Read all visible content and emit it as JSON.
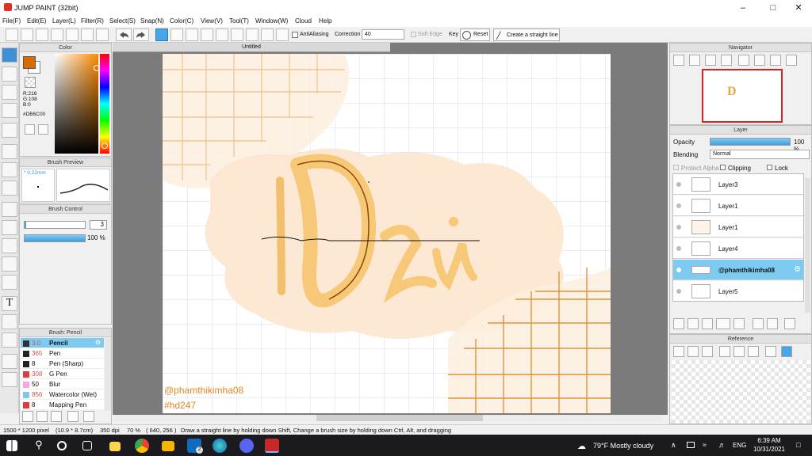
{
  "window": {
    "title": "JUMP PAINT (32bit)"
  },
  "menu": [
    "File(F)",
    "Edit(E)",
    "Layer(L)",
    "Filter(R)",
    "Select(S)",
    "Snap(N)",
    "Color(C)",
    "View(V)",
    "Tool(T)",
    "Window(W)",
    "Cloud",
    "Help"
  ],
  "toolbar": {
    "antialiasing_label": "AntiAliasing",
    "correction_label": "Correction",
    "correction_value": "40",
    "soft_edge_label": "Soft Edge",
    "key_label": "Key",
    "reset_label": "Reset",
    "straight_line_label": "Create a straight line"
  },
  "color_panel": {
    "title": "Color",
    "r": "R:216",
    "g": "G:108",
    "b": "B:0",
    "hex": "#DB6C00",
    "current_color": "#d86c00"
  },
  "brush_preview": {
    "title": "Brush Preview",
    "size": "* 0.22mm"
  },
  "brush_control": {
    "title": "Brush Control",
    "size_value": "3",
    "opacity_value": "100 %"
  },
  "brush_list": {
    "title": "Brush: Pencil",
    "items": [
      {
        "size": "3.0",
        "name": "Pencil",
        "color": "#333333"
      },
      {
        "size": "365",
        "name": "Pen",
        "color": "#222222"
      },
      {
        "size": "8",
        "name": "Pen (Sharp)",
        "color": "#222222"
      },
      {
        "size": "308",
        "name": "G Pen",
        "color": "#e03a3a"
      },
      {
        "size": "50",
        "name": "Blur",
        "color": "#f2a6e6"
      },
      {
        "size": "856",
        "name": "Watercolor (Wet)",
        "color": "#7ec8f0"
      },
      {
        "size": "8",
        "name": "Mapping Pen",
        "color": "#e03a3a"
      }
    ]
  },
  "canvas": {
    "tab": "Untitled",
    "watermark1": "@phamthikimha08",
    "watermark2": "#hd247"
  },
  "navigator": {
    "title": "Navigator"
  },
  "layer_panel": {
    "title": "Layer",
    "opacity_label": "Opacity",
    "opacity_value": "100 %",
    "blending_label": "Blending",
    "blending_value": "Normal",
    "protect_alpha": "Protect Alpha",
    "clipping": "Clipping",
    "lock": "Lock",
    "layers": [
      "Layer3",
      "Layer1",
      "Layer1",
      "Layer4",
      "@phamthikimha08",
      "Layer5"
    ],
    "selected_index": 4
  },
  "reference": {
    "title": "Reference"
  },
  "status": {
    "size": "1500 * 1200 pixel",
    "mm": "(10.9 * 8.7cm)",
    "dpi": "350 dpi",
    "zoom": "70 %",
    "coords": "( 640, 256 )",
    "hint": "Draw a straight line by holding down Shift, Change a brush size by holding down Ctrl, Alt, and dragging"
  },
  "taskbar": {
    "weather": "79°F  Mostly cloudy",
    "lang": "ENG",
    "time": "6:39 AM",
    "date": "10/31/2021",
    "mail_badge": "2"
  }
}
